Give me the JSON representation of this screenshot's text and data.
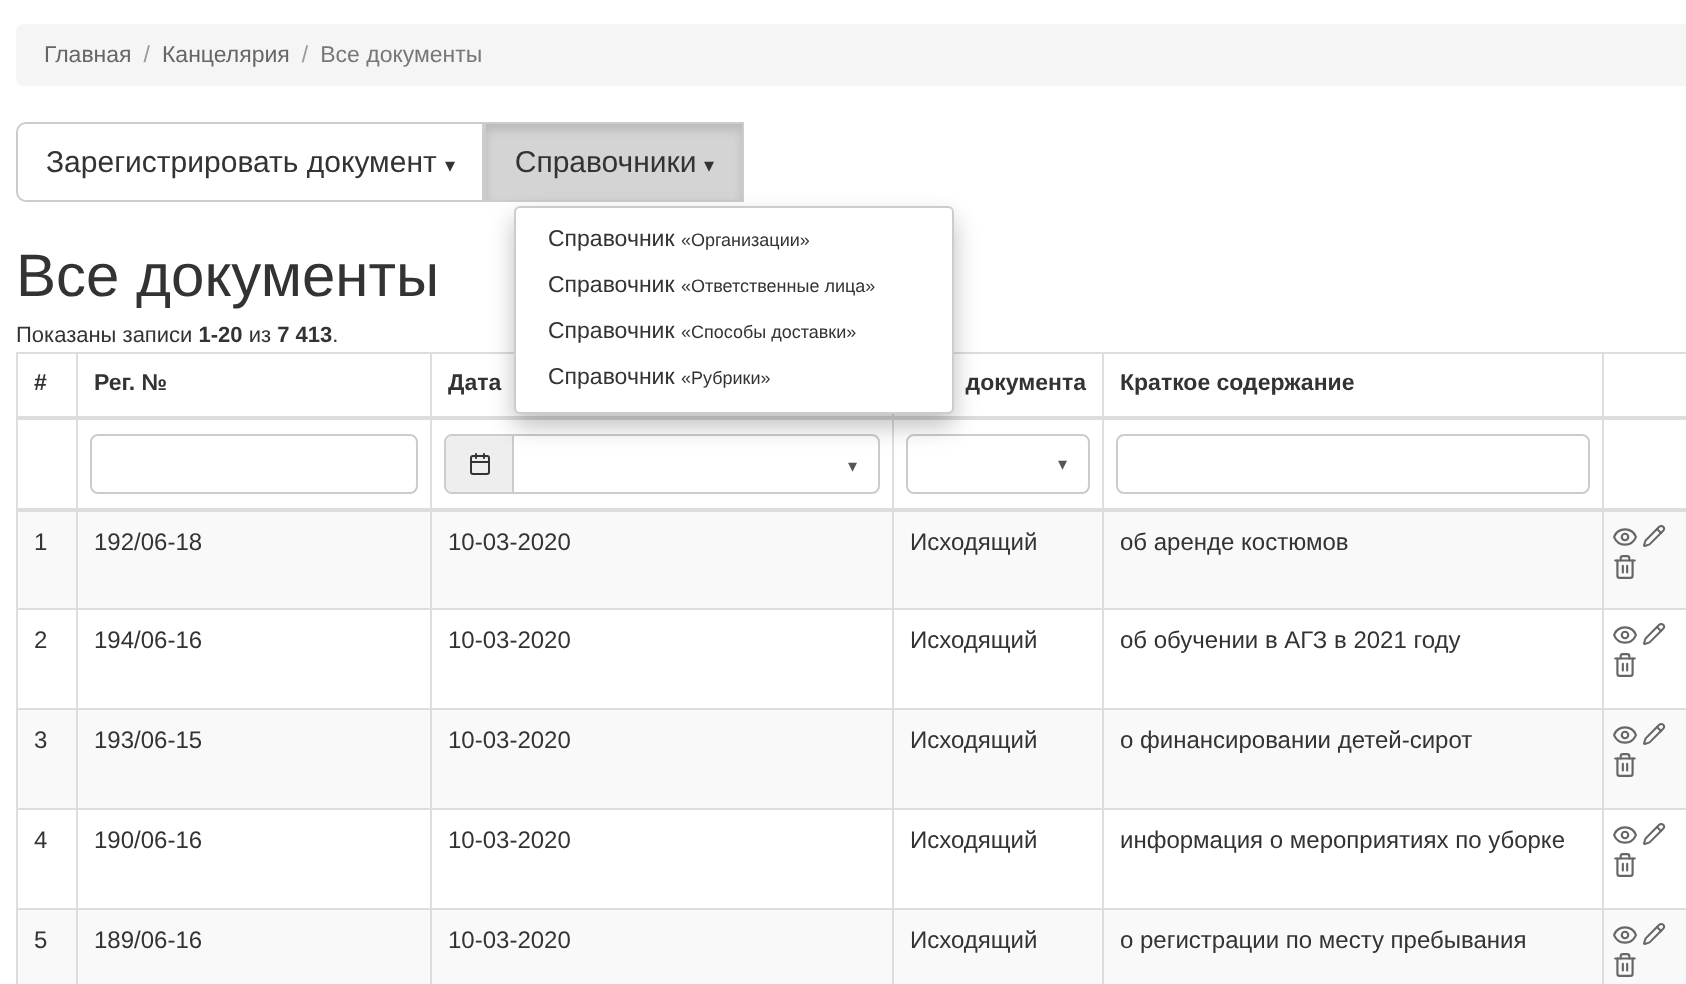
{
  "breadcrumb": [
    {
      "label": "Главная",
      "current": false
    },
    {
      "label": "Канцелярия",
      "current": false
    },
    {
      "label": "Все документы",
      "current": true
    }
  ],
  "breadcrumb_separator": "/",
  "toolbar": [
    {
      "label": "Зарегистрировать документ",
      "caret": "▾",
      "selected": false
    },
    {
      "label": "Справочники",
      "caret": "▾",
      "selected": true
    }
  ],
  "dropdown_menu": [
    {
      "prefix": "Справочник",
      "name": "«Организации»"
    },
    {
      "prefix": "Справочник",
      "name": "«Ответственные лица»"
    },
    {
      "prefix": "Справочник",
      "name": "«Способы доставки»"
    },
    {
      "prefix": "Справочник",
      "name": "«Рубрики»"
    }
  ],
  "page_title": "Все документы",
  "summary": "Показаны записи **1-20** из **7 413**.",
  "table": {
    "columns": [
      "#",
      "Рег. №",
      "Дата",
      "документа",
      "Краткое содержание",
      ""
    ],
    "filters": [
      {
        "kind": "none"
      },
      {
        "kind": "text"
      },
      {
        "kind": "date",
        "caret": "▾"
      },
      {
        "kind": "select",
        "caret": "▾"
      },
      {
        "kind": "text"
      },
      {
        "kind": "none"
      }
    ],
    "rows": [
      {
        "num": "1",
        "reg": "192/06-18",
        "date": "10-03-2020",
        "type": "Исходящий",
        "summary": "об аренде костюмов"
      },
      {
        "num": "2",
        "reg": "194/06-16",
        "date": "10-03-2020",
        "type": "Исходящий",
        "summary": "об обучении в АГЗ в 2021 году"
      },
      {
        "num": "3",
        "reg": "193/06-15",
        "date": "10-03-2020",
        "type": "Исходящий",
        "summary": "о финансировании детей-сирот"
      },
      {
        "num": "4",
        "reg": "190/06-16",
        "date": "10-03-2020",
        "type": "Исходящий",
        "summary": "информация о мероприятиях по уборке"
      },
      {
        "num": "5",
        "reg": "189/06-16",
        "date": "10-03-2020",
        "type": "Исходящий",
        "summary": "о регистрации по месту пребывания"
      }
    ]
  }
}
